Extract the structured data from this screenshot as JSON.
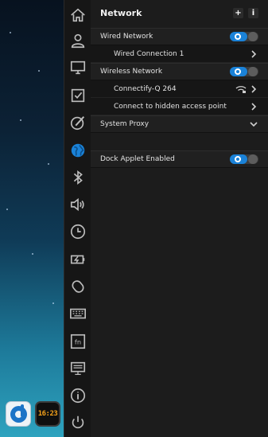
{
  "dock": {
    "clock_text": "16:23"
  },
  "sidebar": {
    "items": [
      {
        "icon": "home-icon"
      },
      {
        "icon": "user-icon"
      },
      {
        "icon": "display-icon"
      },
      {
        "icon": "default-apps-icon"
      },
      {
        "icon": "personalization-icon"
      },
      {
        "icon": "network-globe-icon",
        "active": true
      },
      {
        "icon": "bluetooth-icon"
      },
      {
        "icon": "sound-icon"
      },
      {
        "icon": "date-time-icon"
      },
      {
        "icon": "power-battery-icon"
      },
      {
        "icon": "mouse-icon"
      },
      {
        "icon": "keyboard-icon"
      },
      {
        "icon": "shortcuts-icon",
        "text": "fn"
      },
      {
        "icon": "system-info-icon"
      },
      {
        "icon": "info-icon"
      },
      {
        "icon": "shutdown-icon"
      }
    ]
  },
  "panel": {
    "title": "Network",
    "add_label": "+",
    "info_label": "i"
  },
  "wired": {
    "label": "Wired Network",
    "enabled": true,
    "connection_label": "Wired Connection 1"
  },
  "wireless": {
    "label": "Wireless Network",
    "enabled": true,
    "ssid": "Connectify-Q 264",
    "hidden_label": "Connect to hidden access point"
  },
  "proxy": {
    "label": "System Proxy"
  },
  "dock_applet": {
    "label": "Dock Applet Enabled",
    "enabled": true
  },
  "colors": {
    "accent": "#1a82d8",
    "panel_bg": "#1c1c1c",
    "sidebar_bg": "#161616"
  }
}
